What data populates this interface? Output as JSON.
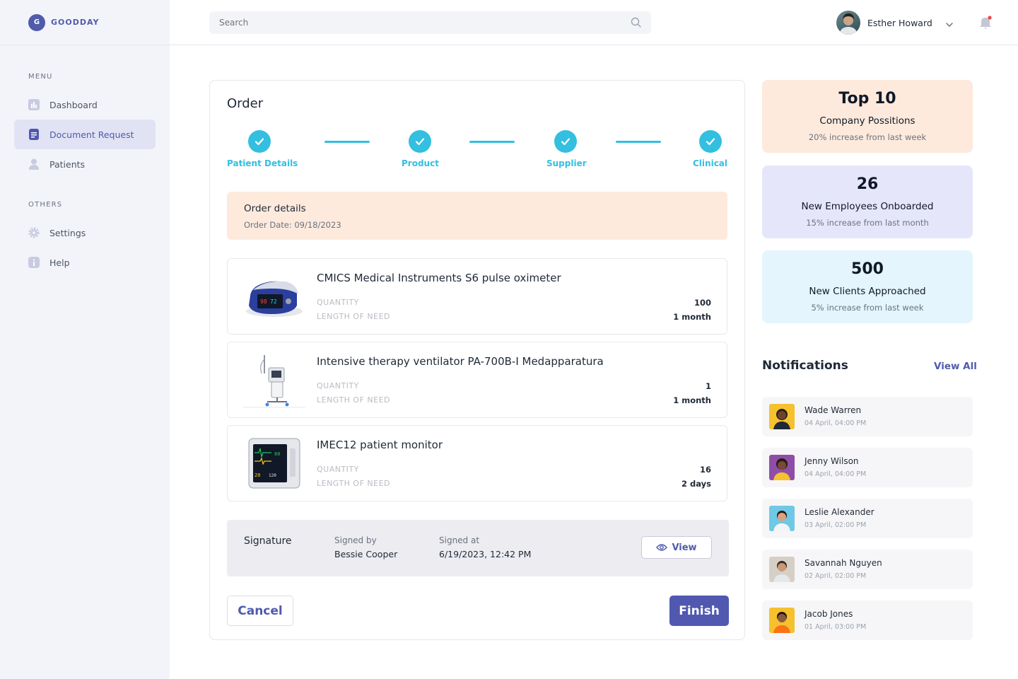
{
  "app": {
    "logo_letter": "G",
    "name": "GOODDAY"
  },
  "sidebar": {
    "menu_heading": "MENU",
    "menu_items": [
      {
        "label": "Dashboard",
        "icon": "chart-icon"
      },
      {
        "label": "Document Request",
        "icon": "document-icon",
        "active": true
      },
      {
        "label": "Patients",
        "icon": "user-icon"
      }
    ],
    "others_heading": "OTHERS",
    "others_items": [
      {
        "label": "Settings",
        "icon": "gear-icon"
      },
      {
        "label": "Help",
        "icon": "info-icon"
      }
    ]
  },
  "header": {
    "search_placeholder": "Search",
    "user_name": "Esther Howard"
  },
  "order": {
    "title": "Order",
    "steps": [
      "Patient Details",
      "Product",
      "Supplier",
      "Clinical"
    ],
    "details_title": "Order details",
    "details_date": "Order Date: 09/18/2023",
    "products": [
      {
        "name": "CMICS Medical Instruments S6 pulse oximeter",
        "quantity_label": "QUANTITY",
        "length_label": "LENGTH OF NEED",
        "quantity": "100",
        "length": "1 month"
      },
      {
        "name": "Intensive therapy ventilator PA-700B-I Medapparatura",
        "quantity_label": "QUANTITY",
        "length_label": "LENGTH OF NEED",
        "quantity": "1",
        "length": "1 month"
      },
      {
        "name": "IMEC12 patient monitor",
        "quantity_label": "QUANTITY",
        "length_label": "LENGTH OF NEED",
        "quantity": "16",
        "length": "2 days"
      }
    ],
    "signature": {
      "title": "Signature",
      "signed_by_label": "Signed by",
      "signed_by": "Bessie Cooper",
      "signed_at_label": "Signed at",
      "signed_at": "6/19/2023, 12:42 PM",
      "view_label": "View"
    },
    "cancel_label": "Cancel",
    "finish_label": "Finish"
  },
  "stats": [
    {
      "value": "Top 10",
      "label": "Company Possitions",
      "sub": "20% increase from last week",
      "color": "#fdeadc"
    },
    {
      "value": "26",
      "label": "New Employees Onboarded",
      "sub": "15% increase from last month",
      "color": "#e6e6fb"
    },
    {
      "value": "500",
      "label": "New Clients Approached",
      "sub": "5% increase from last week",
      "color": "#e4f5fd"
    }
  ],
  "notifications": {
    "title": "Notifications",
    "view_all": "View All",
    "items": [
      {
        "name": "Wade Warren",
        "time": "04 April,  04:00 PM"
      },
      {
        "name": "Jenny Wilson",
        "time": "04 April, 04:00 PM"
      },
      {
        "name": "Leslie Alexander",
        "time": "03 April, 02:00 PM"
      },
      {
        "name": "Savannah Nguyen",
        "time": "02 April, 02:00 PM"
      },
      {
        "name": "Jacob Jones",
        "time": "01 April, 03:00 PM"
      }
    ]
  },
  "colors": {
    "accent": "#4f5bab",
    "step": "#33bfe0",
    "finish": "#5058b0",
    "notification_dot": "#ef4444"
  }
}
